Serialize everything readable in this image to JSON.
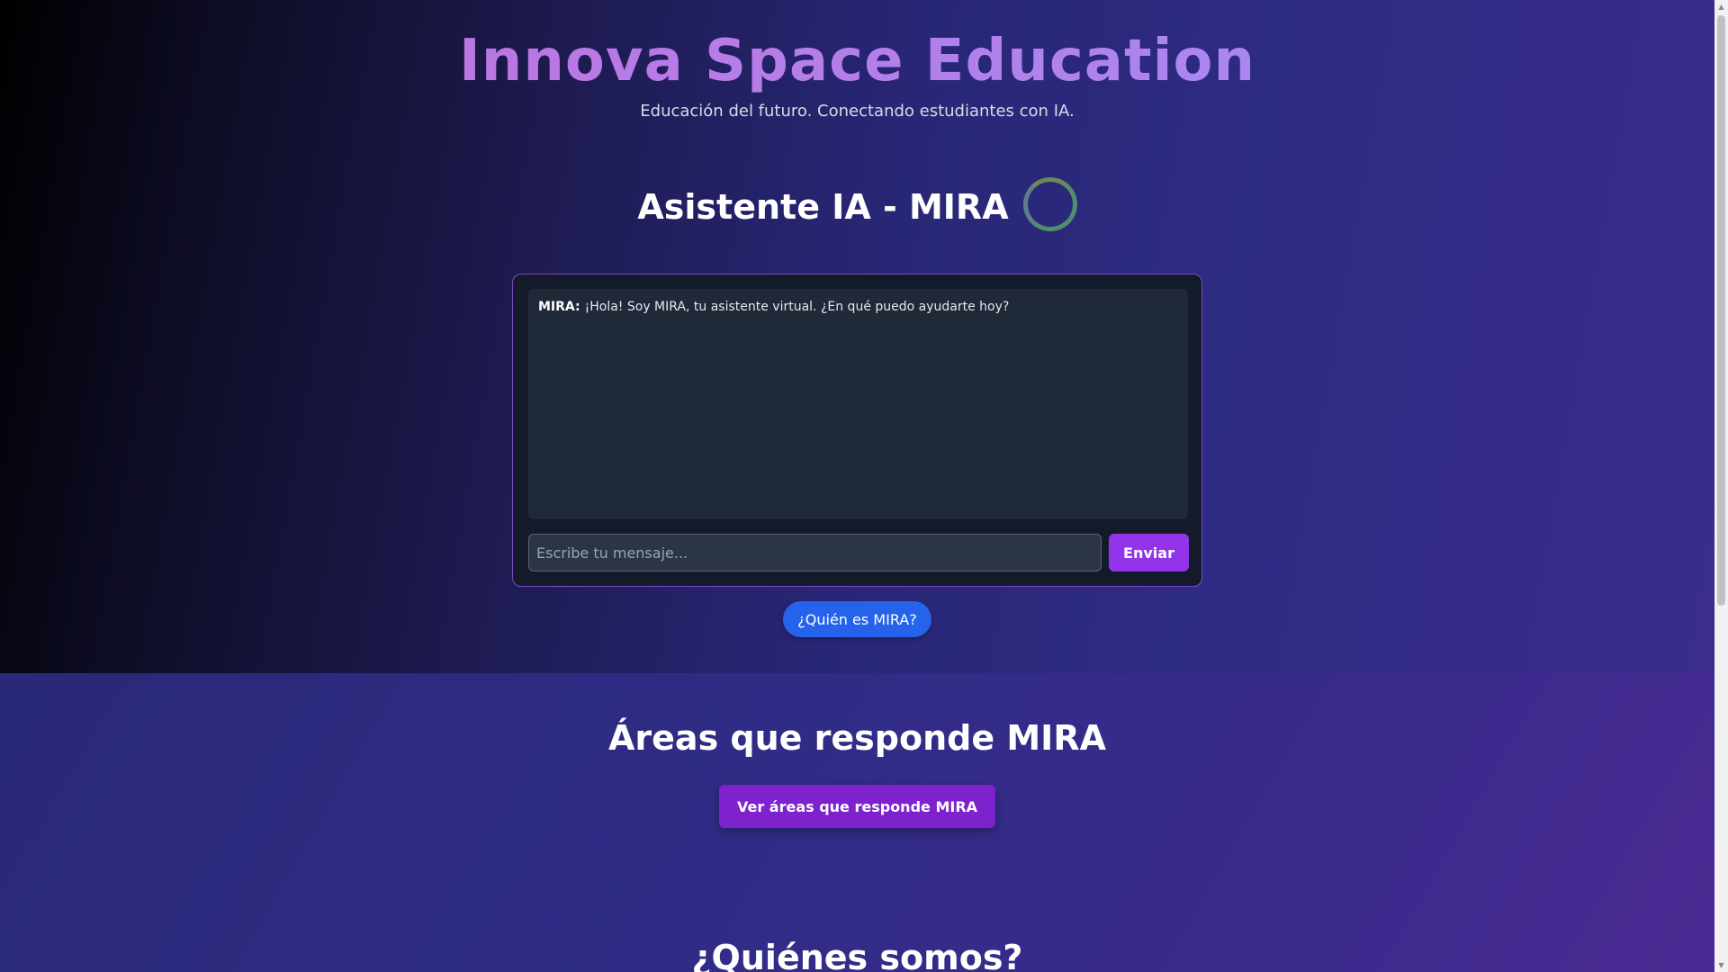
{
  "header": {
    "site_title": "Innova Space Education",
    "tagline": "Educación del futuro. Conectando estudiantes con IA."
  },
  "assistant": {
    "heading": "Asistente IA - MIRA",
    "status_icon": "loading-ring-icon",
    "messages": [
      {
        "sender": "MIRA:",
        "text": "¡Hola! Soy MIRA, tu asistente virtual. ¿En qué puedo ayudarte hoy?"
      }
    ],
    "input": {
      "placeholder": "Escribe tu mensaje...",
      "value": ""
    },
    "send_label": "Enviar",
    "who_label": "¿Quién es MIRA?"
  },
  "areas": {
    "heading": "Áreas que responde MIRA",
    "button_label": "Ver áreas que responde MIRA"
  },
  "about": {
    "heading": "¿Quiénes somos?"
  },
  "colors": {
    "send_button": "#9333ea",
    "who_button": "#2563eb",
    "areas_button": "#7e22ce",
    "chat_border": "#7c4bc4"
  }
}
